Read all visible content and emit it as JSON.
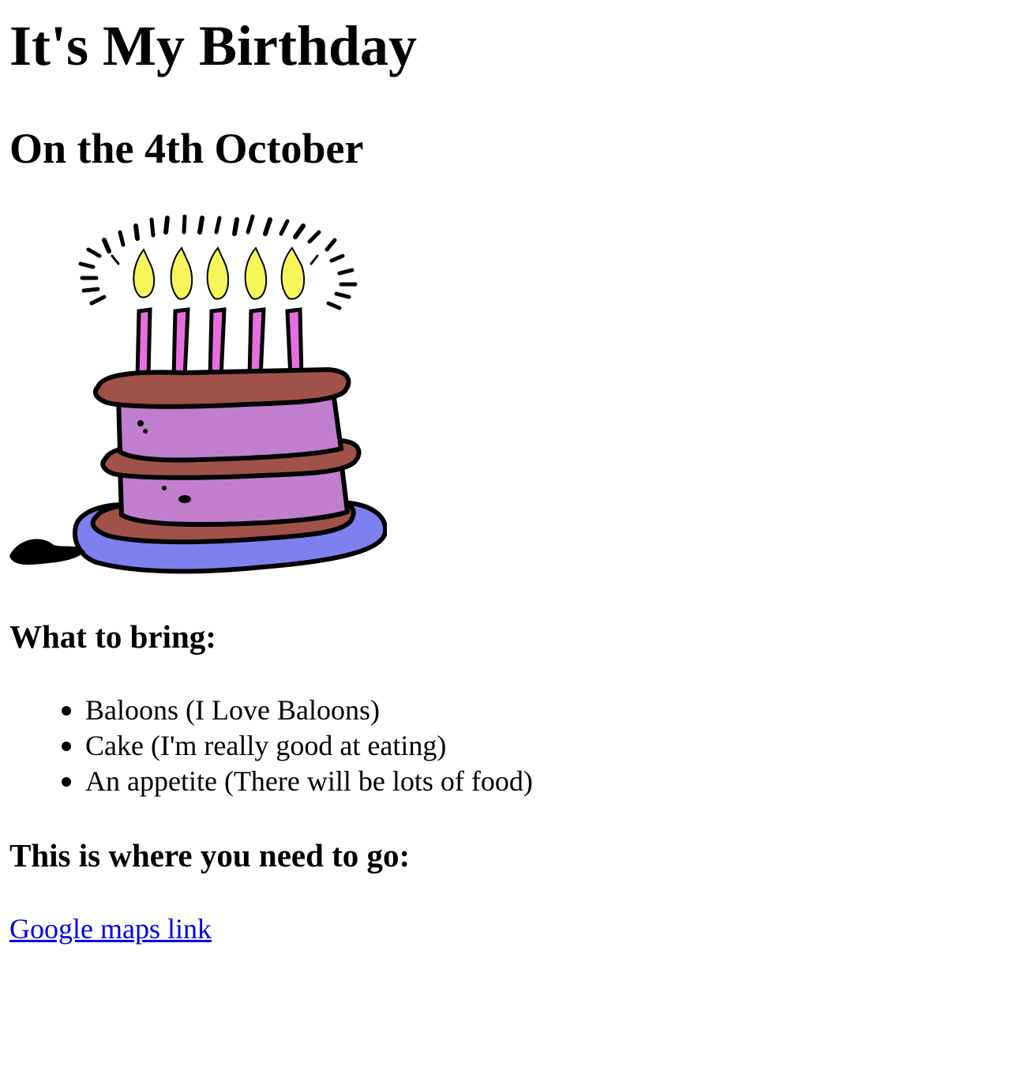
{
  "header": {
    "title": "It's My Birthday",
    "subtitle": "On the 4th October"
  },
  "image": {
    "icon": "birthday-cake-icon",
    "colors": {
      "cake": "#c07ecc",
      "icing": "#a0524a",
      "plate": "#7f80f0",
      "flame": "#f8f55a",
      "candle": "#e86ee0",
      "outline": "#000000"
    }
  },
  "bring": {
    "heading": "What to bring:",
    "items": [
      "Baloons (I Love Baloons)",
      "Cake (I'm really good at eating)",
      "An appetite (There will be lots of food)"
    ]
  },
  "location": {
    "heading": "This is where you need to go:",
    "link_text": "Google maps link"
  },
  "colors": {
    "link": "#0000ee",
    "text": "#000000",
    "background": "#ffffff"
  }
}
